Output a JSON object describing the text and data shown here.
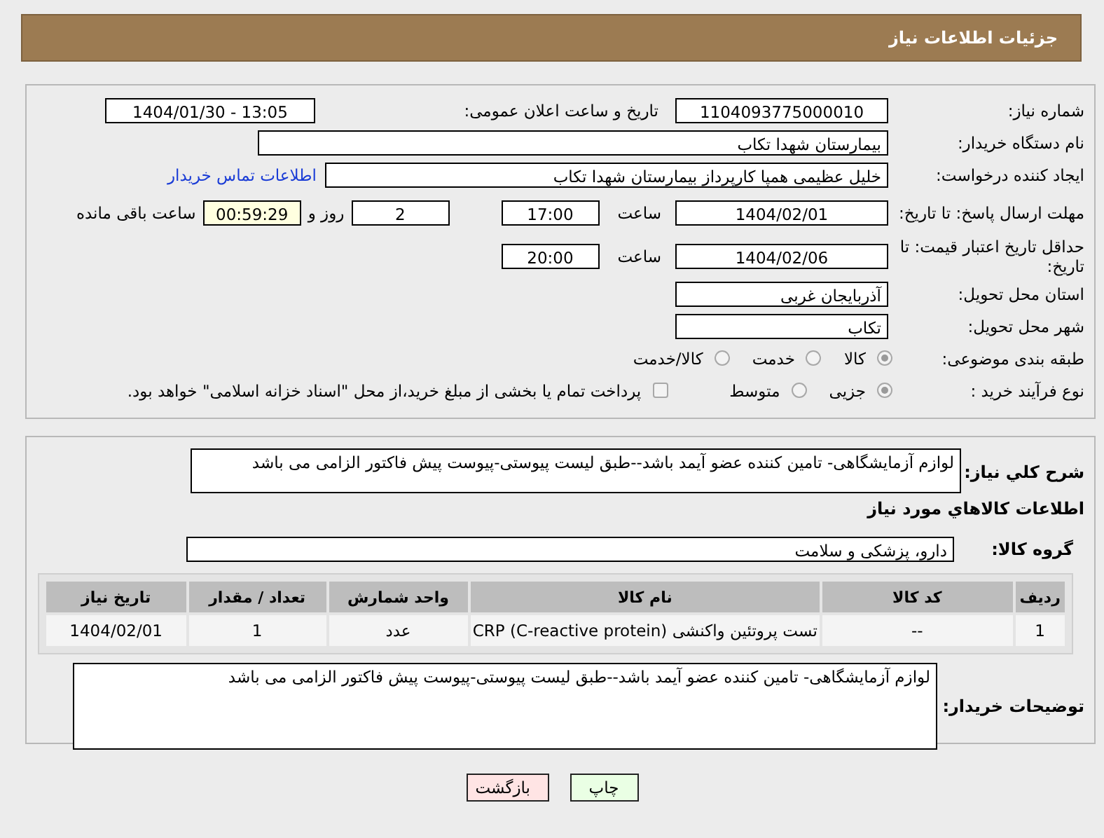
{
  "header": {
    "title": "جزئیات اطلاعات نیاز"
  },
  "need_number": {
    "label": "شماره نیاز:",
    "value": "1104093775000010"
  },
  "announce": {
    "label": "تاریخ و ساعت اعلان عمومی:",
    "value": "1404/01/30 - 13:05"
  },
  "buyer": {
    "label": "نام دستگاه خریدار:",
    "value": "بیمارستان شهدا تکاب"
  },
  "creator": {
    "label": "ایجاد کننده درخواست:",
    "value": "خلیل عظیمی همپا کارپرداز بیمارستان شهدا تکاب",
    "link": "اطلاعات تماس خریدار"
  },
  "deadline": {
    "label": "مهلت ارسال پاسخ: تا تاریخ:",
    "date": "1404/02/01",
    "time_label": "ساعت",
    "time": "17:00",
    "days": "2",
    "days_label": "روز و",
    "remaining": "00:59:29",
    "remaining_label": "ساعت باقی مانده"
  },
  "validity": {
    "label": "حداقل تاریخ اعتبار قیمت: تا تاریخ:",
    "date": "1404/02/06",
    "time_label": "ساعت",
    "time": "20:00"
  },
  "province": {
    "label": "استان محل تحویل:",
    "value": "آذربایجان غربی"
  },
  "city": {
    "label": "شهر محل تحویل:",
    "value": "تکاب"
  },
  "category": {
    "label": "طبقه بندی موضوعی:",
    "options": [
      {
        "label": "کالا",
        "selected": true
      },
      {
        "label": "خدمت",
        "selected": false
      },
      {
        "label": "کالا/خدمت",
        "selected": false
      }
    ]
  },
  "process": {
    "label": "نوع فرآیند خرید :",
    "options": [
      {
        "label": "جزیی",
        "selected": true
      },
      {
        "label": "متوسط",
        "selected": false
      }
    ],
    "payment": {
      "label": "پرداخت تمام یا بخشی از مبلغ خرید،از محل \"اسناد خزانه اسلامی\" خواهد بود.",
      "checked": false
    }
  },
  "description": {
    "label": "شرح کلي نياز:",
    "value": "لوازم آزمایشگاهی- تامین کننده عضو آیمد باشد--طبق لیست پیوستی-پیوست پیش فاکتور الزامی می باشد"
  },
  "goods_heading": "اطلاعات كالاهاي مورد نياز",
  "goods_group": {
    "label": "گروه کالا:",
    "value": "دارو، پزشکی و سلامت"
  },
  "table": {
    "columns": [
      "ردیف",
      "کد کالا",
      "نام کالا",
      "واحد شمارش",
      "تعداد / مقدار",
      "تاریخ نیاز"
    ],
    "rows": [
      [
        "1",
        "--",
        "تست پروتئین واکنشی (CRP (C-reactive protein",
        "عدد",
        "1",
        "1404/02/01"
      ]
    ]
  },
  "buyer_notes": {
    "label": "توضیحات خریدار:",
    "value": "لوازم آزمایشگاهی- تامین کننده عضو آیمد باشد--طبق لیست پیوستی-پیوست پیش فاکتور الزامی می باشد"
  },
  "buttons": [
    {
      "label": "چاپ",
      "kind": "print"
    },
    {
      "label": "بازگشت",
      "kind": "back"
    }
  ]
}
